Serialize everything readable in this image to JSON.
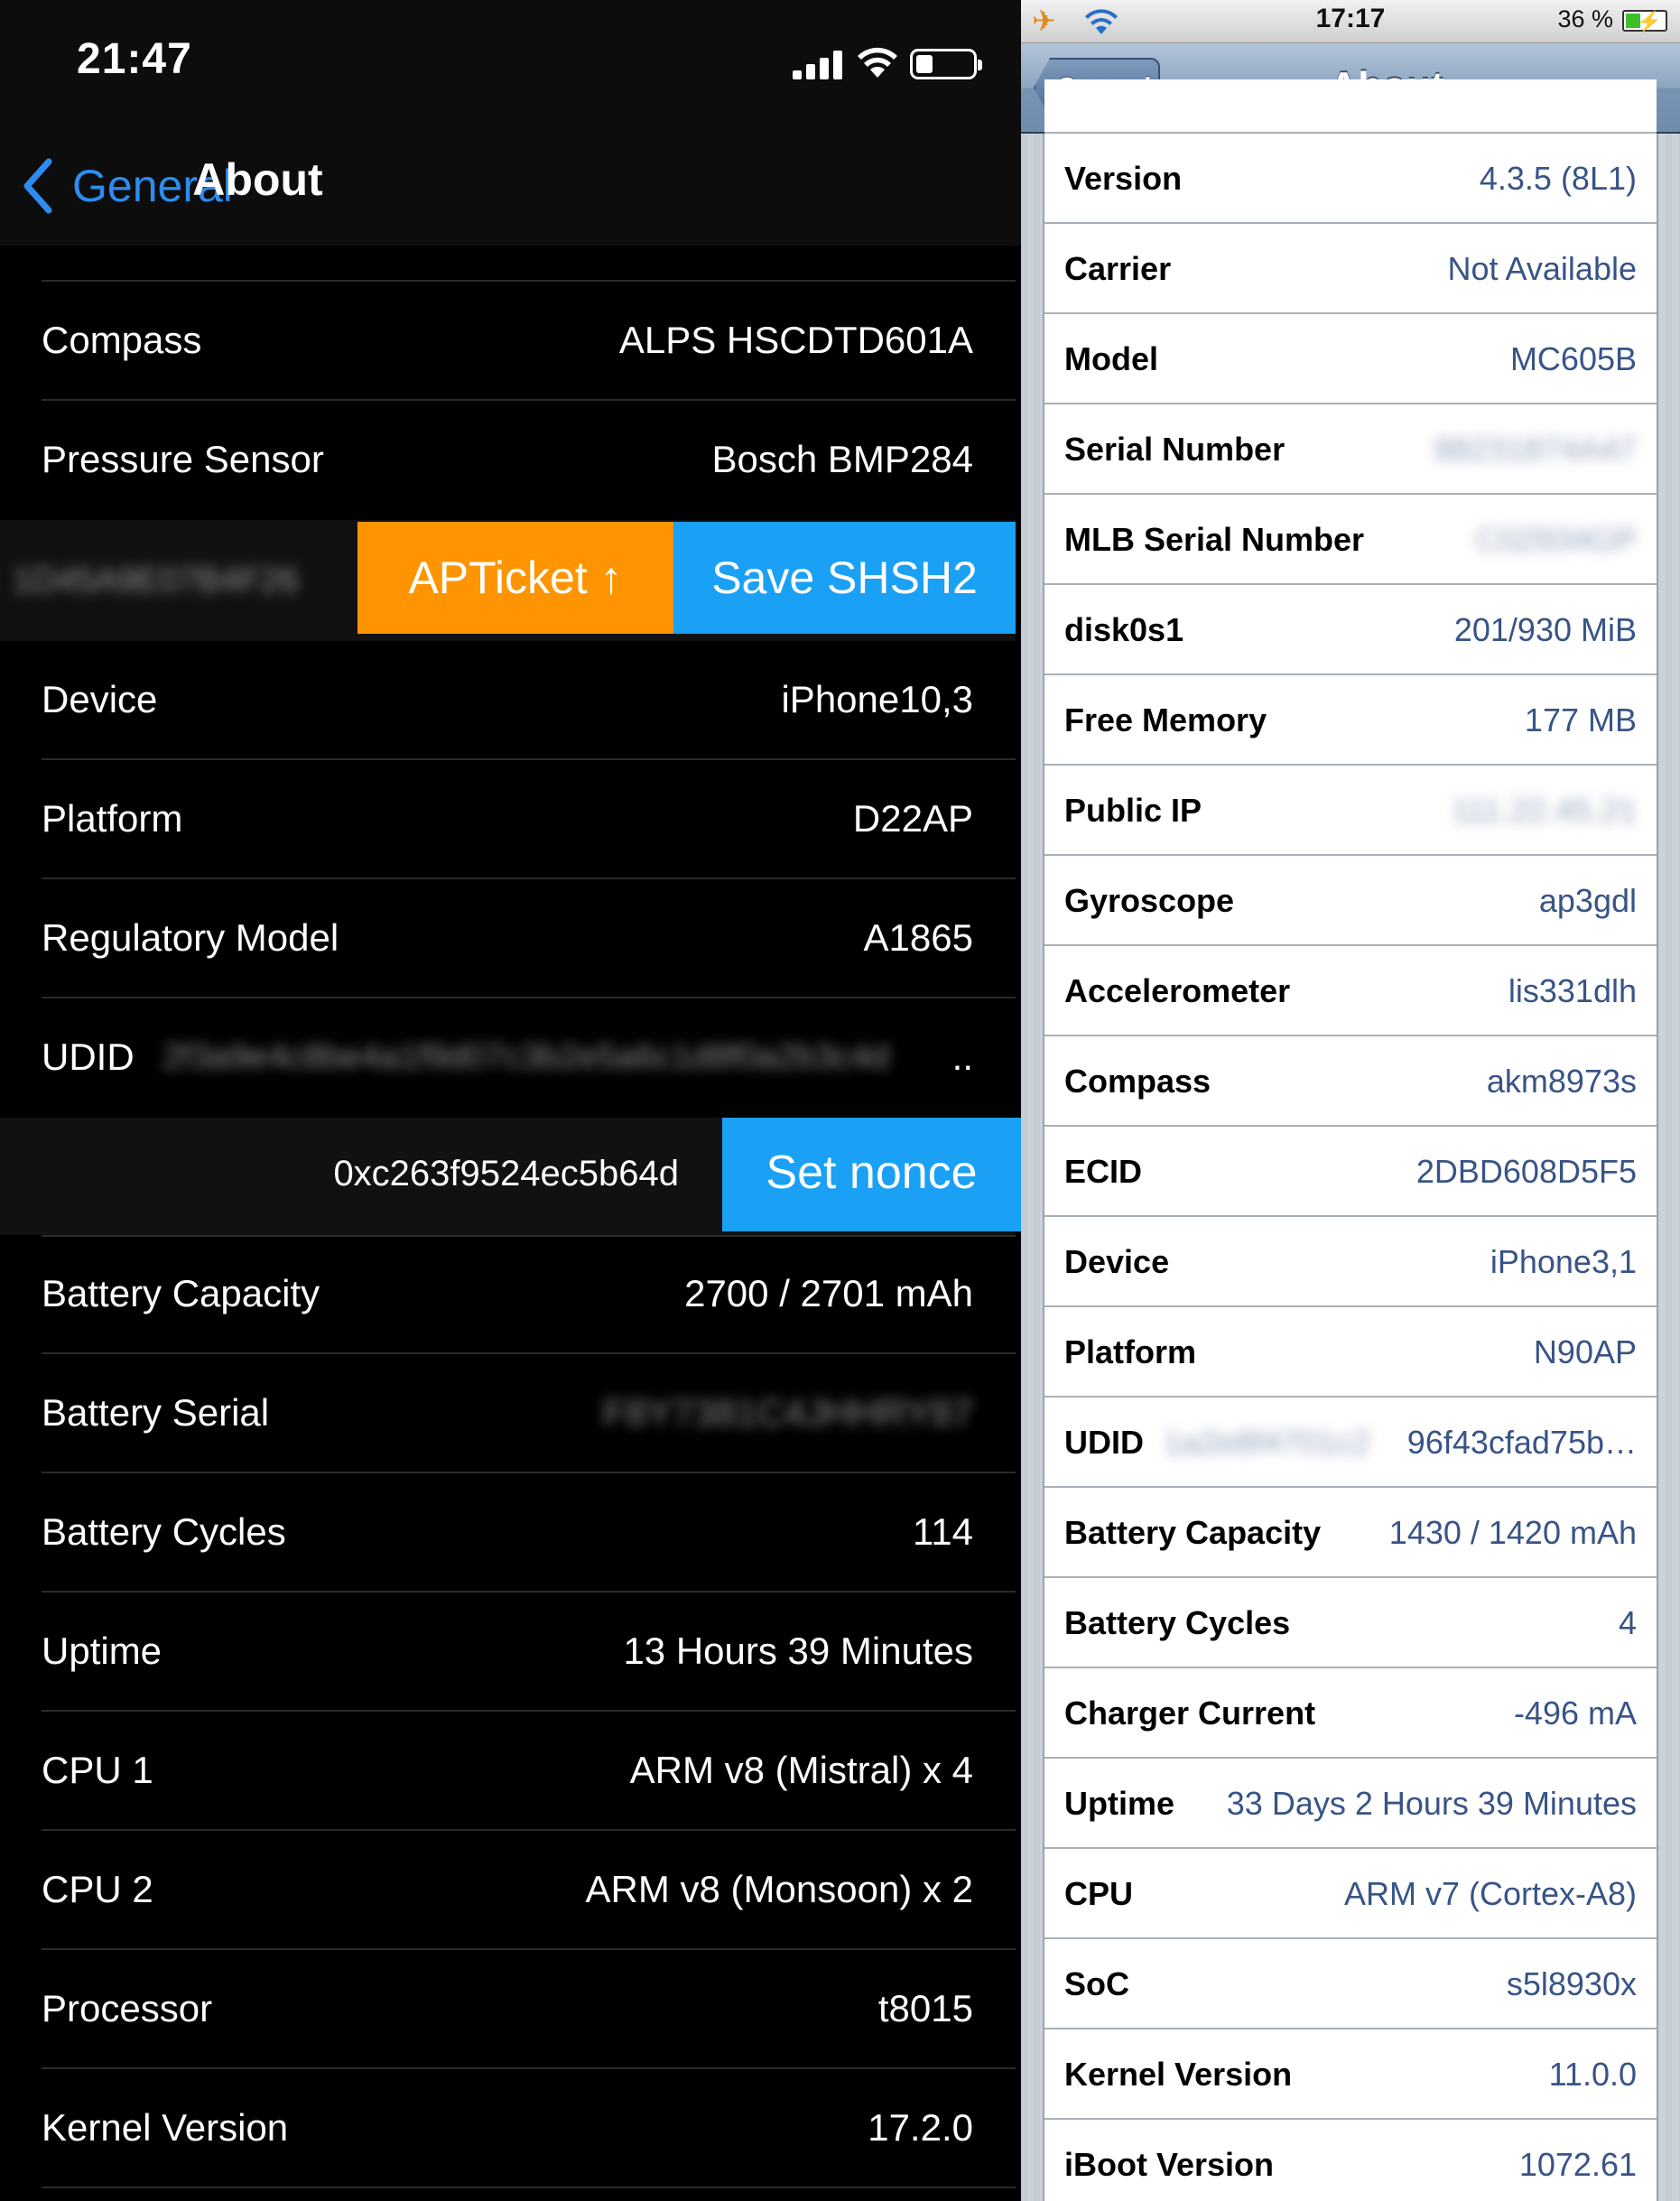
{
  "left": {
    "status": {
      "time": "21:47"
    },
    "nav": {
      "back_label": "General",
      "title": "About"
    },
    "rows_top": [
      {
        "key": "Compass",
        "value": "ALPS HSCDTD601A"
      },
      {
        "key": "Pressure Sensor",
        "value": "Bosch BMP284"
      }
    ],
    "swipe1": {
      "hidden_value": "1D45A9E07B4F26",
      "apticket_label": "APTicket ↑",
      "save_label": "Save SHSH2"
    },
    "rows_mid": [
      {
        "key": "Device",
        "value": "iPhone10,3"
      },
      {
        "key": "Platform",
        "value": "D22AP"
      },
      {
        "key": "Regulatory Model",
        "value": "A1865"
      }
    ],
    "udid": {
      "key": "UDID",
      "value": "2f3a9e4c8be4a1f9d07c3b2e5a6c1d8f0a2b3c4d",
      "suffix": ".."
    },
    "swipe2": {
      "nonce": "0xc263f9524ec5b64d",
      "set_label": "Set nonce"
    },
    "rows_bottom": [
      {
        "key": "Battery Capacity",
        "value": "2700 / 2701 mAh"
      },
      {
        "key": "Battery Serial",
        "value": "F8Y7381C4JHHRY87",
        "blurred": true
      },
      {
        "key": "Battery Cycles",
        "value": "114"
      },
      {
        "key": "Uptime",
        "value": "13 Hours 39 Minutes"
      },
      {
        "key": "CPU 1",
        "value": "ARM v8 (Mistral) x 4"
      },
      {
        "key": "CPU 2",
        "value": "ARM v8 (Monsoon) x 2"
      },
      {
        "key": "Processor",
        "value": "t8015"
      },
      {
        "key": "Kernel Version",
        "value": "17.2.0"
      }
    ]
  },
  "right": {
    "status": {
      "time": "17:17",
      "battery_percent": "36 %"
    },
    "nav": {
      "back_label": "General",
      "title": "About"
    },
    "rows": [
      {
        "key": "Version",
        "value": "4.3.5 (8L1)"
      },
      {
        "key": "Carrier",
        "value": "Not Available"
      },
      {
        "key": "Model",
        "value": "MC605B"
      },
      {
        "key": "Serial Number",
        "value": "88231874A47",
        "blurred": true
      },
      {
        "key": "MLB Serial Number",
        "value": "C02934GP",
        "blurred": true
      },
      {
        "key": "disk0s1",
        "value": "201/930 MiB"
      },
      {
        "key": "Free Memory",
        "value": "177 MB"
      },
      {
        "key": "Public IP",
        "value": "111.22.45.21",
        "blurred": true
      },
      {
        "key": "Gyroscope",
        "value": "ap3gdl"
      },
      {
        "key": "Accelerometer",
        "value": "lis331dlh"
      },
      {
        "key": "Compass",
        "value": "akm8973s"
      },
      {
        "key": "ECID",
        "value": "2DBD608D5F5"
      },
      {
        "key": "Device",
        "value": "iPhone3,1"
      },
      {
        "key": "Platform",
        "value": "N90AP"
      },
      {
        "key": "UDID",
        "value": "96f43cfad75b…",
        "prefix_blur": "1a2e8f4701c2"
      },
      {
        "key": "Battery Capacity",
        "value": "1430 / 1420 mAh"
      },
      {
        "key": "Battery Cycles",
        "value": "4"
      },
      {
        "key": "Charger Current",
        "value": "-496 mA"
      },
      {
        "key": "Uptime",
        "value": "33 Days 2 Hours 39 Minutes"
      },
      {
        "key": "CPU",
        "value": "ARM v7 (Cortex-A8)"
      },
      {
        "key": "SoC",
        "value": "s5l8930x"
      },
      {
        "key": "Kernel Version",
        "value": "11.0.0"
      },
      {
        "key": "iBoot Version",
        "value": "1072.61"
      }
    ]
  },
  "colors": {
    "dark_accent": "#2d8cf0",
    "apticket": "#fe9500",
    "shsh_blue": "#1aa0f5",
    "classic_value": "#385487"
  },
  "icons": [
    "cellular-signal-icon",
    "wifi-icon",
    "battery-icon",
    "chevron-left-icon",
    "airplane-icon",
    "charging-bolt-icon"
  ]
}
